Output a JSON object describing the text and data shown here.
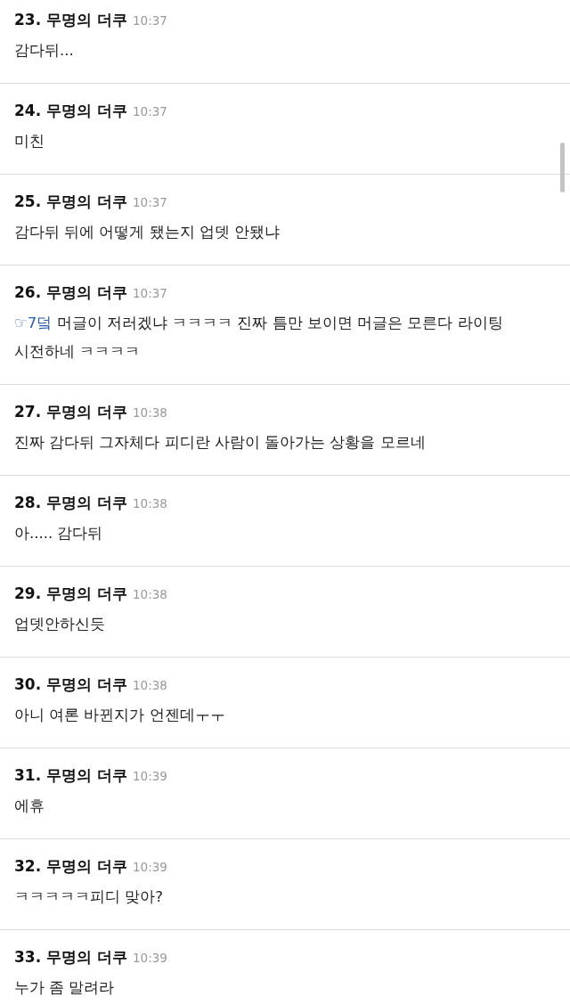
{
  "comments": [
    {
      "number": "23.",
      "author": "무명의 더쿠",
      "time": "10:37",
      "text": "감다뒤..."
    },
    {
      "number": "24.",
      "author": "무명의 더쿠",
      "time": "10:37",
      "text": "미친"
    },
    {
      "number": "25.",
      "author": "무명의 더쿠",
      "time": "10:37",
      "text": "감다뒤 뒤에 어떻게 됐는지 업뎃 안됐냐"
    },
    {
      "number": "26.",
      "author": "무명의 더쿠",
      "time": "10:37",
      "reply_to": "☞7덬",
      "text": "머글이 저러겠냐 ㅋㅋㅋㅋ 진짜 틈만 보이면 머글은 모른다 라이팅 시전하네 ㅋㅋㅋㅋ"
    },
    {
      "number": "27.",
      "author": "무명의 더쿠",
      "time": "10:38",
      "text": "진짜 감다뒤 그자체다 피디란 사람이 돌아가는 상황을 모르네"
    },
    {
      "number": "28.",
      "author": "무명의 더쿠",
      "time": "10:38",
      "text": "아..... 감다뒤"
    },
    {
      "number": "29.",
      "author": "무명의 더쿠",
      "time": "10:38",
      "text": "업뎃안하신듯"
    },
    {
      "number": "30.",
      "author": "무명의 더쿠",
      "time": "10:38",
      "text": "아니 여론 바뀐지가 언젠데ㅜㅜ"
    },
    {
      "number": "31.",
      "author": "무명의 더쿠",
      "time": "10:39",
      "text": "에휴"
    },
    {
      "number": "32.",
      "author": "무명의 더쿠",
      "time": "10:39",
      "text": "ㅋㅋㅋㅋㅋ피디 맞아?"
    },
    {
      "number": "33.",
      "author": "무명의 더쿠",
      "time": "10:39",
      "text": "누가 좀 말려라"
    }
  ]
}
